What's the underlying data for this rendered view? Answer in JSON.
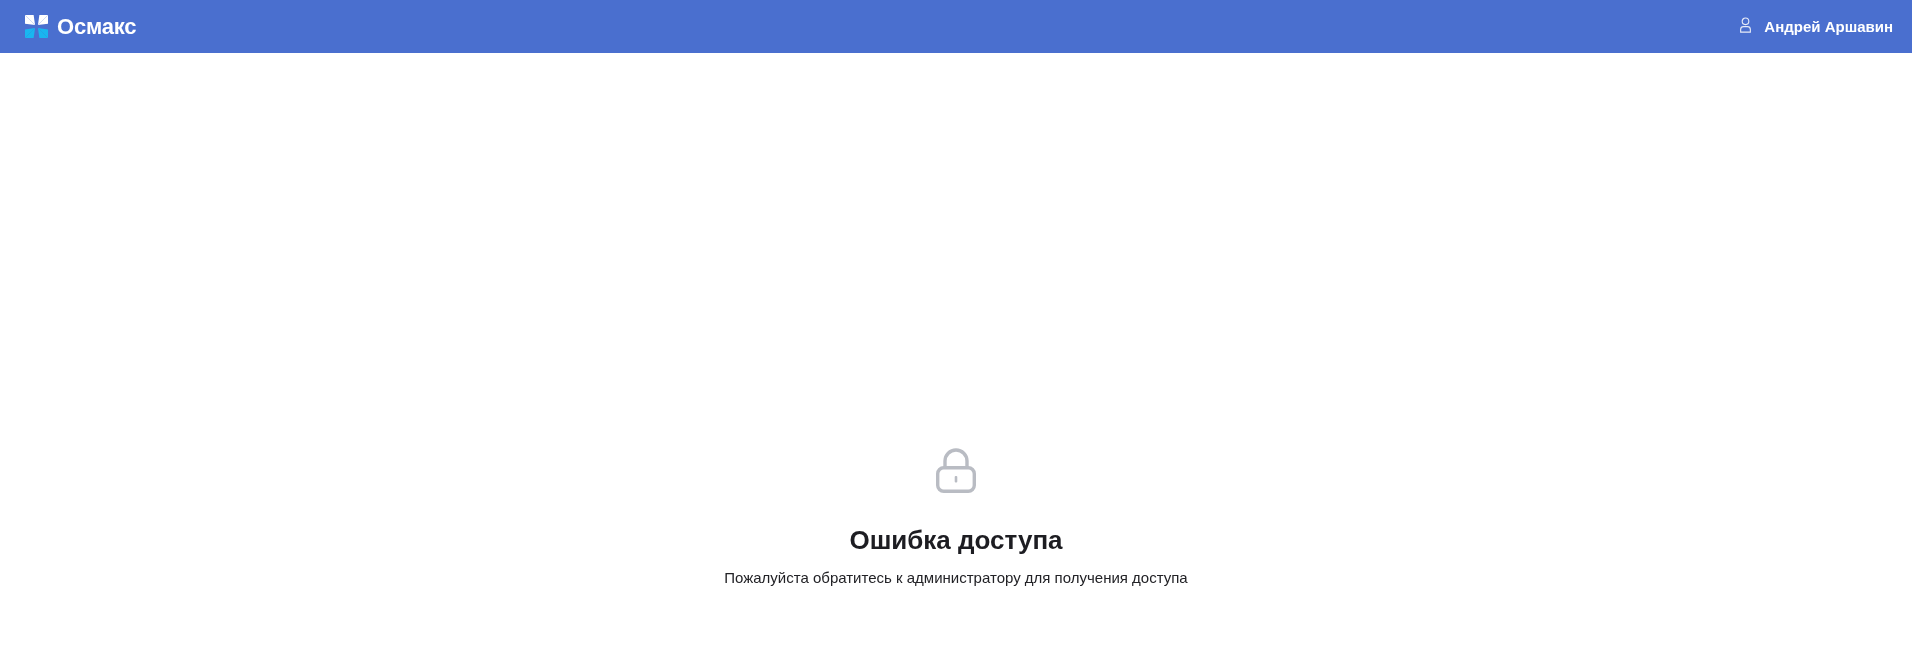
{
  "header": {
    "logo": {
      "text": "Осмакс"
    },
    "user": {
      "name": "Андрей Аршавин"
    }
  },
  "error": {
    "title": "Ошибка доступа",
    "message": "Пожалуйста обратитесь к администратору для получения доступа"
  }
}
